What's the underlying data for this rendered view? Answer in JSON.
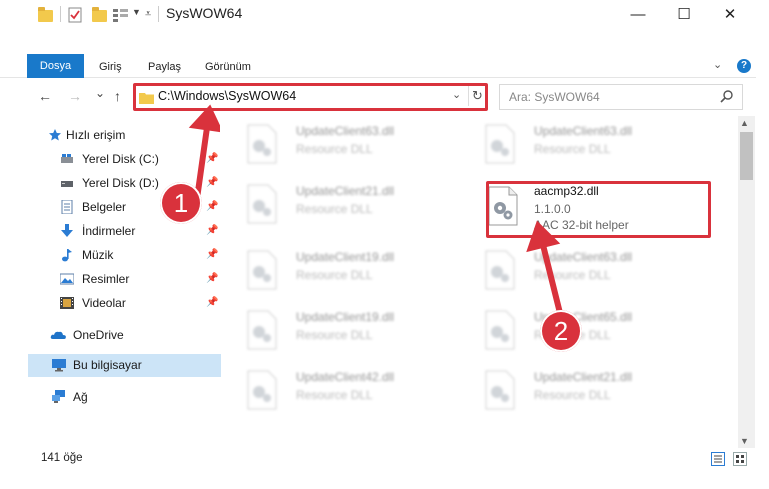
{
  "window": {
    "title": "SysWOW64",
    "minimize": "—",
    "maximize": "☐",
    "close": "✕"
  },
  "ribbon": {
    "tabs": [
      "Dosya",
      "Giriş",
      "Paylaş",
      "Görünüm"
    ],
    "help": "?"
  },
  "nav": {
    "back": "←",
    "forward": "→",
    "recent": "⌄",
    "up": "↑",
    "address": "C:\\Windows\\SysWOW64",
    "search_placeholder": "Ara: SysWOW64"
  },
  "sidebar": {
    "items": [
      {
        "label": "Hızlı erişim",
        "icon": "star-icon",
        "pinned": false
      },
      {
        "label": "Yerel Disk (C:)",
        "icon": "drive-icon",
        "pinned": true
      },
      {
        "label": "Yerel Disk (D:)",
        "icon": "drive-icon",
        "pinned": true
      },
      {
        "label": "Belgeler",
        "icon": "document-icon",
        "pinned": true
      },
      {
        "label": "İndirmeler",
        "icon": "download-icon",
        "pinned": true
      },
      {
        "label": "Müzik",
        "icon": "music-icon",
        "pinned": true
      },
      {
        "label": "Resimler",
        "icon": "pictures-icon",
        "pinned": true
      },
      {
        "label": "Videolar",
        "icon": "video-icon",
        "pinned": true
      },
      {
        "label": "OneDrive",
        "icon": "cloud-icon",
        "pinned": false
      },
      {
        "label": "Bu bilgisayar",
        "icon": "computer-icon",
        "pinned": false,
        "selected": true
      },
      {
        "label": "Ağ",
        "icon": "network-icon",
        "pinned": false
      }
    ]
  },
  "files": [
    {
      "name": "UpdateClient63.dll",
      "desc": "Resource DLL"
    },
    {
      "name": "UpdateClient63.dll",
      "desc": "Resource DLL"
    },
    {
      "name": "UpdateClient21.dll",
      "desc": "Resource DLL"
    },
    {
      "name": "aacmp32.dll",
      "version": "1.1.0.0",
      "desc": "AAC 32-bit helper",
      "highlighted": true
    },
    {
      "name": "UpdateClient19.dll",
      "desc": "Resource DLL"
    },
    {
      "name": "UpdateClient63.dll",
      "desc": "Resource DLL"
    },
    {
      "name": "UpdateClient19.dll",
      "desc": "Resource DLL"
    },
    {
      "name": "UpdateClient65.dll",
      "desc": "Resource DLL"
    },
    {
      "name": "UpdateClient42.dll",
      "desc": "Resource DLL"
    },
    {
      "name": "UpdateClient21.dll",
      "desc": "Resource DLL"
    }
  ],
  "annotations": {
    "step1": "1",
    "step2": "2",
    "color": "#d9323c"
  },
  "status": {
    "item_count": "141 öğe"
  },
  "colors": {
    "accent": "#1979ca",
    "selection": "#cce4f7",
    "folder": "#f2c94c"
  }
}
